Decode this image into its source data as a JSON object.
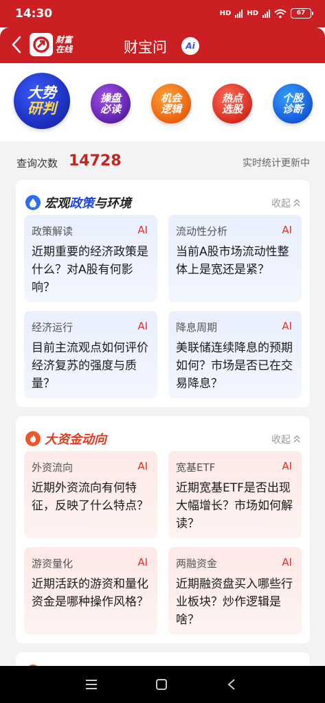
{
  "status_bar": {
    "time": "14:30",
    "network1": "HD",
    "network2": "HD",
    "battery": "67"
  },
  "header": {
    "logo_text_line1": "财富",
    "logo_text_line2": "在线",
    "title": "财宝问",
    "ai_badge": "Ai"
  },
  "top_nav": [
    {
      "line1": "大势",
      "line2": "研判"
    },
    {
      "line1": "操盘",
      "line2": "必读"
    },
    {
      "line1": "机会",
      "line2": "逻辑"
    },
    {
      "line1": "热点",
      "line2": "选股"
    },
    {
      "line1": "个股",
      "line2": "诊断"
    }
  ],
  "stats": {
    "label": "查询次数",
    "count": "14728",
    "note": "实时统计更新中"
  },
  "sections": [
    {
      "title_icon": "water-drop-icon",
      "title_part1": "宏观",
      "title_highlight": "政策",
      "title_part2": "与环境",
      "collapse_label": "收起",
      "cards": [
        {
          "tag": "政策解读",
          "ai": "AI",
          "question": "近期重要的经济政策是什么？对A股有何影响？"
        },
        {
          "tag": "流动性分析",
          "ai": "AI",
          "question": "当前A股市场流动性整体上是宽还是紧？"
        },
        {
          "tag": "经济运行",
          "ai": "AI",
          "question": "目前主流观点如何评价经济复苏的强度与质量？"
        },
        {
          "tag": "降息周期",
          "ai": "AI",
          "question": "美联储连续降息的预期如何？市场是否已在交易降息？"
        }
      ]
    },
    {
      "title_icon": "flame-icon",
      "title_part1": "",
      "title_highlight": "大资金动向",
      "title_part2": "",
      "collapse_label": "收起",
      "cards": [
        {
          "tag": "外资流向",
          "ai": "AI",
          "question": "近期外资流向有何特征，反映了什么特点？"
        },
        {
          "tag": "宽基ETF",
          "ai": "AI",
          "question": "近期宽基ETF是否出现大幅增长？市场如何解读？"
        },
        {
          "tag": "游资量化",
          "ai": "AI",
          "question": "近期活跃的游资和量化资金是哪种操作风格？"
        },
        {
          "tag": "两融资金",
          "ai": "AI",
          "question": "近期融资盘买入哪些行业板块？炒作逻辑是啥？"
        }
      ]
    }
  ],
  "colors": {
    "brand_red": "#cc1f24",
    "count_red": "#c7231f",
    "blue_accent": "#1d44e8",
    "orange_accent": "#e33a1c"
  }
}
